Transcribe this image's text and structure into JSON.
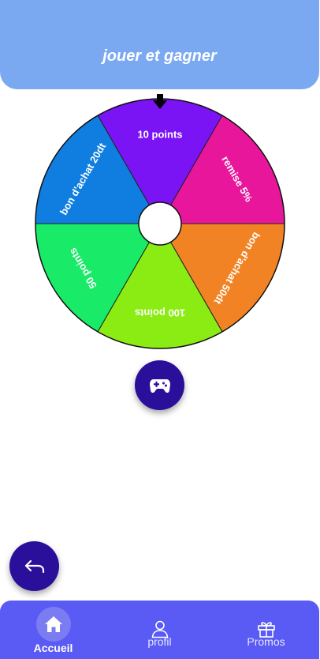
{
  "header": {
    "title": "jouer et gagner"
  },
  "wheel": {
    "segments": [
      {
        "label": "10 points",
        "color": "#7a14f5"
      },
      {
        "label": "remise 5%",
        "color": "#e8169b"
      },
      {
        "label": "bon d'achat 50dt",
        "color": "#f28325"
      },
      {
        "label": "100 points",
        "color": "#8aec12"
      },
      {
        "label": "50 points",
        "color": "#19ea67"
      },
      {
        "label": "bon d'achat 20dt",
        "color": "#0f7ee0"
      }
    ],
    "pointer_icon": "arrow-down-icon"
  },
  "play_button": {
    "icon": "gamepad-icon",
    "color": "#2a0f9b"
  },
  "back_button": {
    "icon": "return-arrow-icon",
    "color": "#2a0f9b"
  },
  "bottom_nav": {
    "color": "#5a5af5",
    "items": [
      {
        "label": "Accueil",
        "icon": "home-icon",
        "active": true
      },
      {
        "label": "profil",
        "icon": "user-icon",
        "active": false
      },
      {
        "label": "Promos",
        "icon": "gift-icon",
        "active": false
      }
    ]
  },
  "colors": {
    "header_bg": "#7aa9f2",
    "accent": "#2a0f9b"
  }
}
